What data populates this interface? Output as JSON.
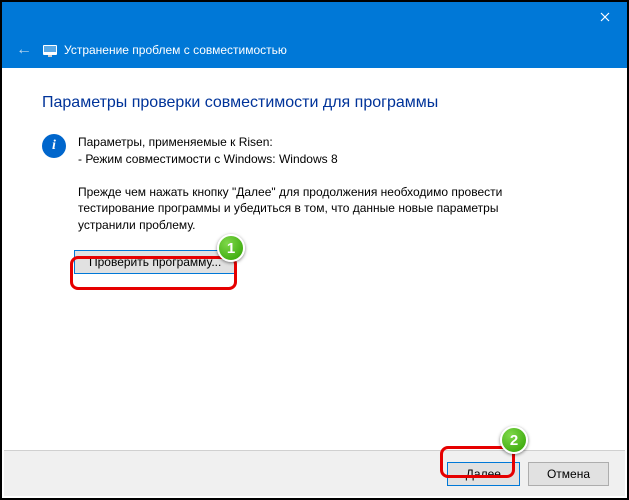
{
  "window": {
    "title": "Устранение проблем с совместимостью"
  },
  "content": {
    "heading": "Параметры проверки совместимости для программы",
    "info_line1": "Параметры, применяемые к Risen:",
    "info_line2": "- Режим совместимости с Windows: Windows 8",
    "instruction": "Прежде чем нажать кнопку \"Далее\" для продолжения необходимо провести тестирование программы и убедиться в том, что данные новые параметры устранили проблему.",
    "test_button": "Проверить программу..."
  },
  "footer": {
    "next": "Далее",
    "cancel": "Отмена"
  },
  "annotations": {
    "badge1": "1",
    "badge2": "2"
  }
}
